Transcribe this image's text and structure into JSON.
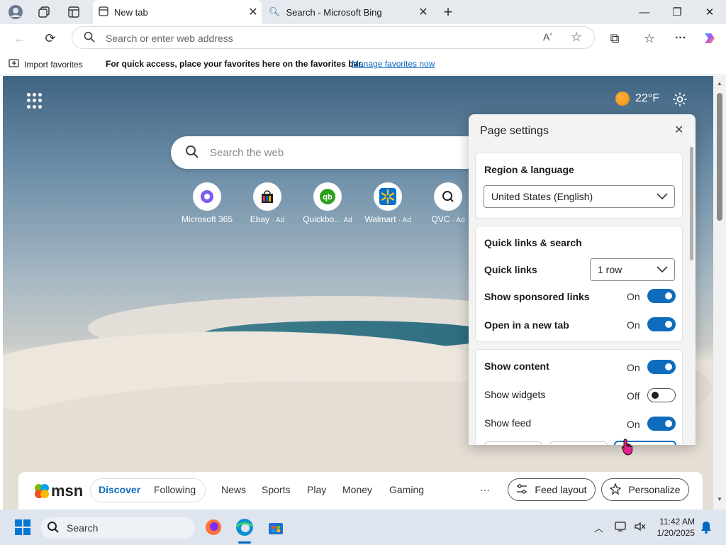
{
  "browser": {
    "tabs": [
      {
        "title": "New tab",
        "active": true
      },
      {
        "title": "Search - Microsoft Bing",
        "active": false
      }
    ],
    "address_placeholder": "Search or enter web address",
    "favorites_bar": {
      "import_label": "Import favorites",
      "message": "For quick access, place your favorites here on the favorites bar.",
      "manage_link": "Manage favorites now"
    }
  },
  "newtab": {
    "weather": {
      "temp": "22°F"
    },
    "search_placeholder": "Search the web",
    "quick_links": [
      {
        "label": "Microsoft 365",
        "ad": ""
      },
      {
        "label": "Ebay",
        "ad": "· Ad"
      },
      {
        "label": "Quickbo...",
        "ad": "Ad"
      },
      {
        "label": "Walmart",
        "ad": "· Ad"
      },
      {
        "label": "QVC",
        "ad": "· Ad"
      }
    ]
  },
  "page_settings": {
    "title": "Page settings",
    "region": {
      "heading": "Region & language",
      "value": "United States (English)"
    },
    "quick": {
      "heading": "Quick links & search",
      "quick_links_label": "Quick links",
      "quick_links_value": "1 row",
      "sponsored_label": "Show sponsored links",
      "sponsored_state": "On",
      "new_tab_label": "Open in a new tab",
      "new_tab_state": "On"
    },
    "content": {
      "show_content_label": "Show content",
      "show_content_state": "On",
      "widgets_label": "Show widgets",
      "widgets_state": "Off",
      "feed_label": "Show feed",
      "feed_state": "On"
    }
  },
  "msn": {
    "logo": "msn",
    "tabs": [
      "Discover",
      "Following"
    ],
    "nav": [
      "News",
      "Sports",
      "Play",
      "Money",
      "Gaming"
    ],
    "more": "···",
    "feed_layout": "Feed layout",
    "personalize": "Personalize"
  },
  "taskbar": {
    "search": "Search",
    "time": "11:42 AM",
    "date": "1/20/2025"
  },
  "colors": {
    "accent": "#0f6cbd",
    "link": "#0b66c3"
  }
}
